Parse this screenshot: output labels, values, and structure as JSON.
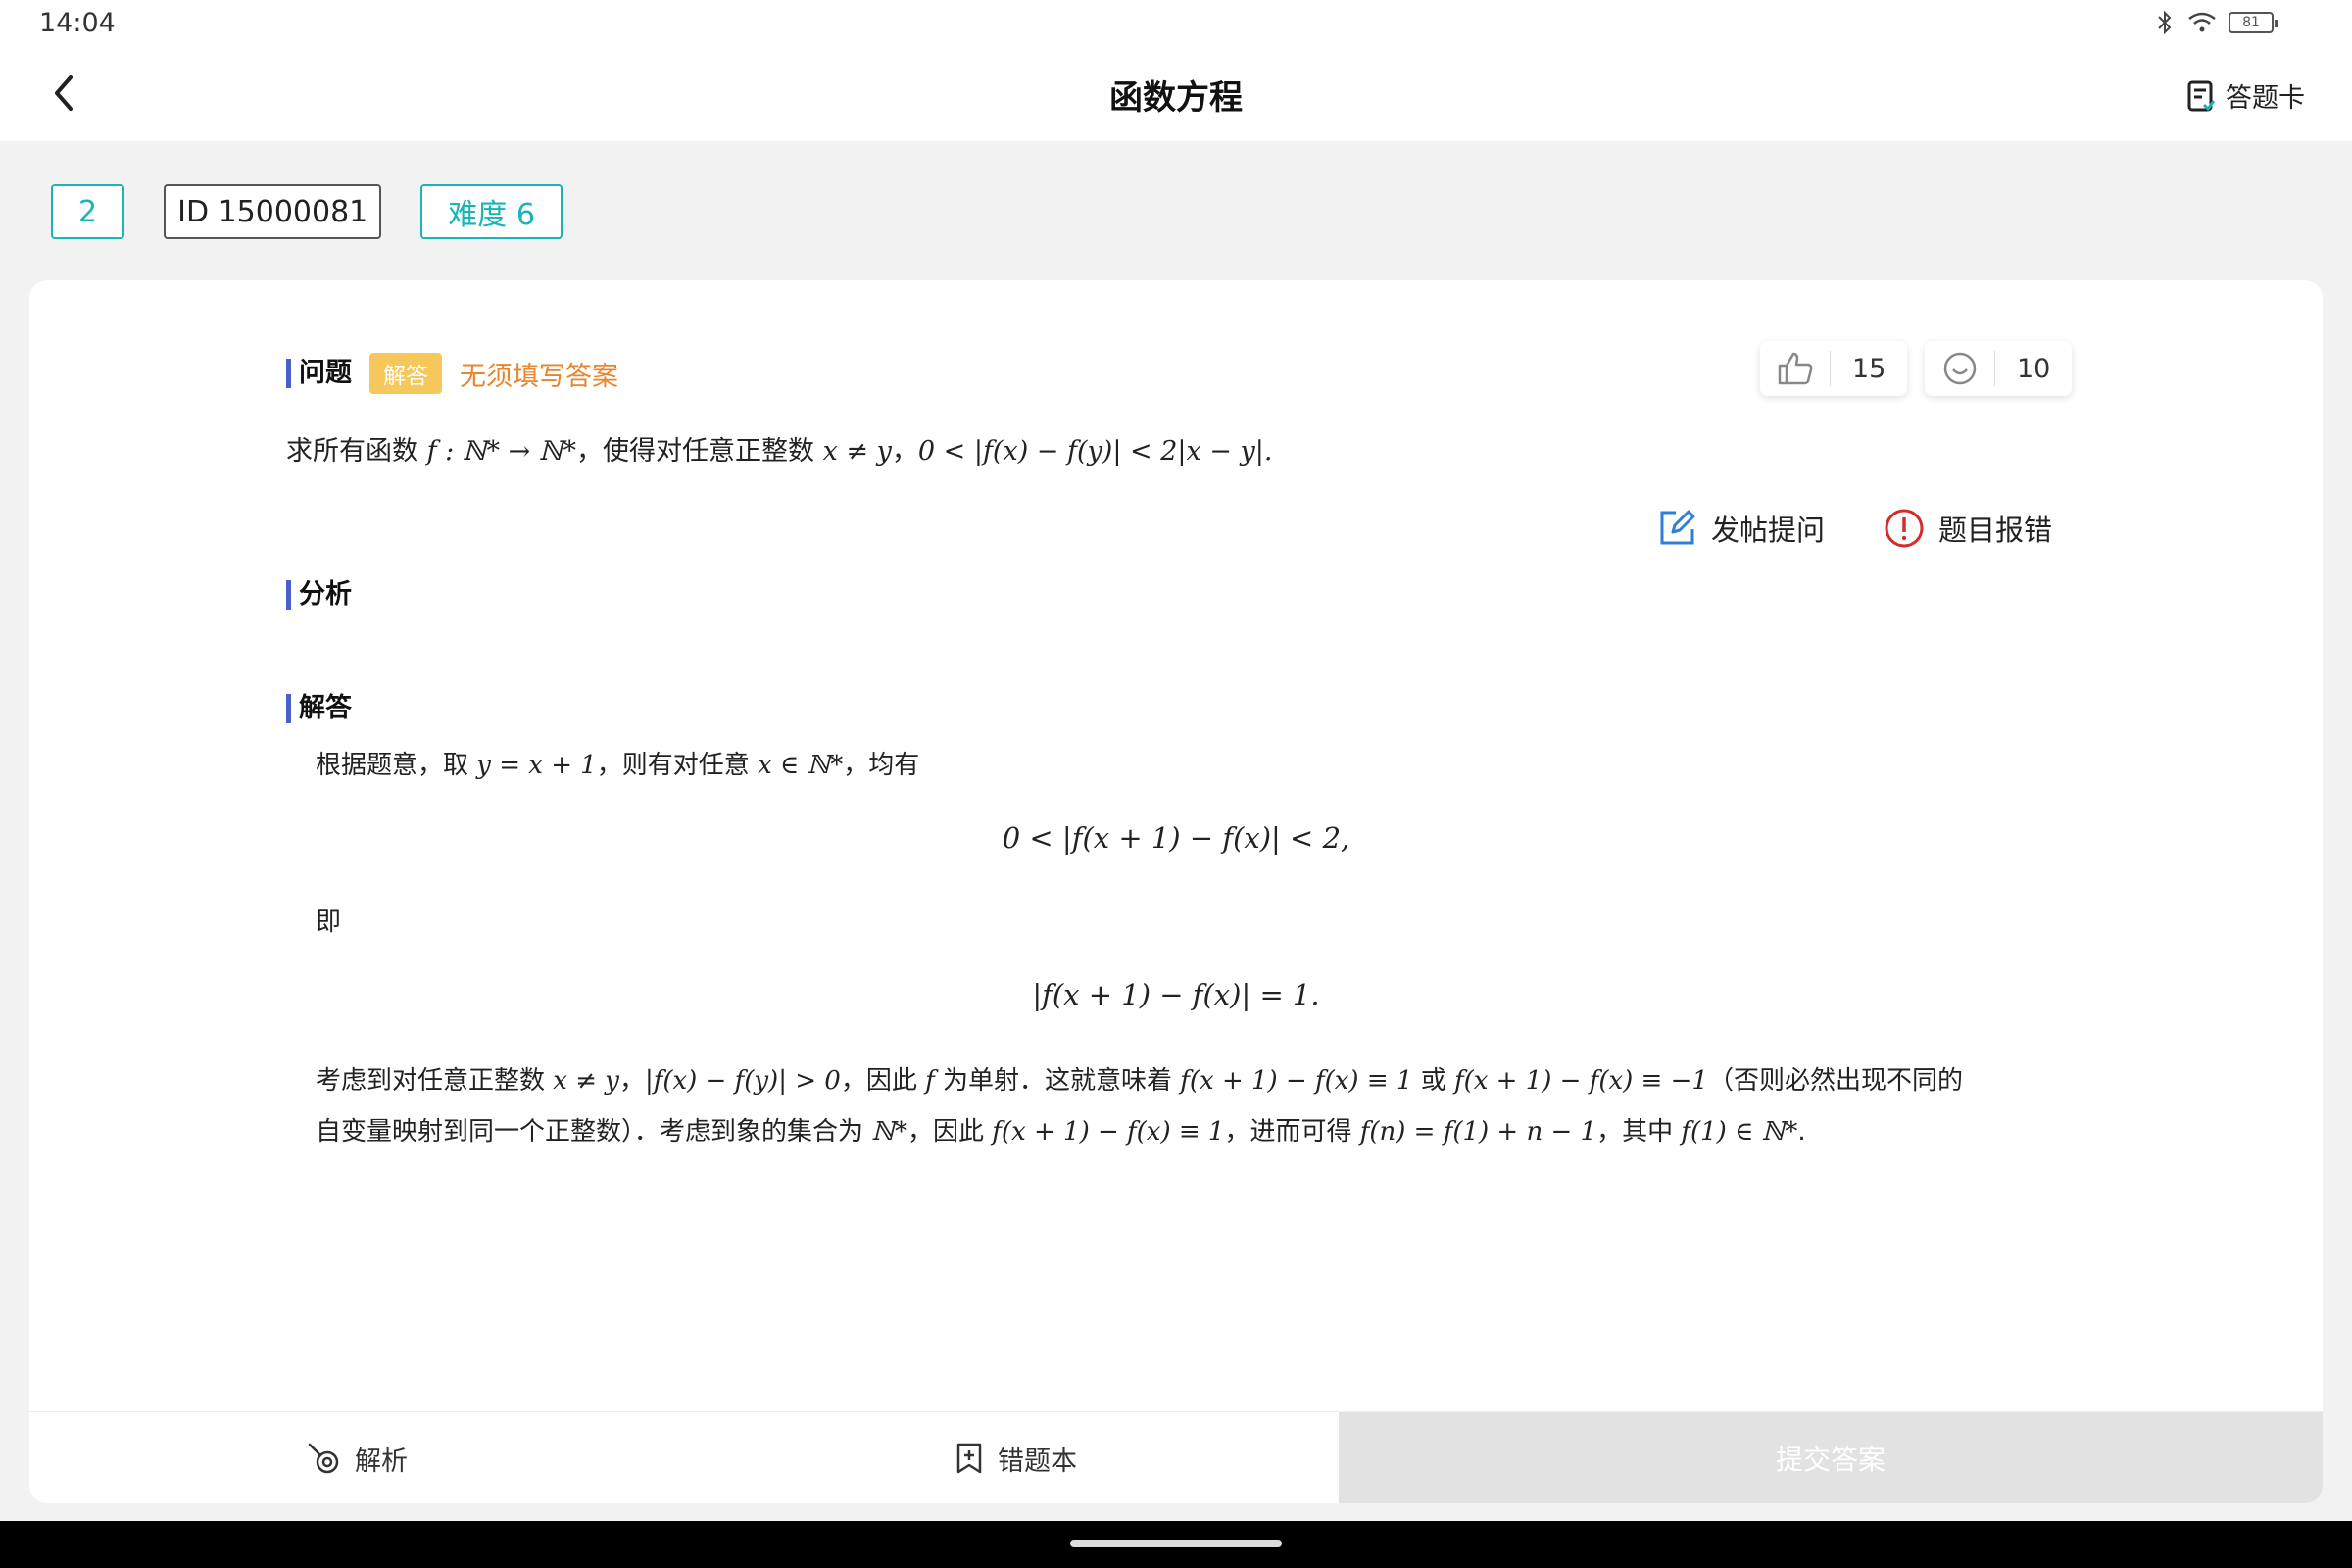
{
  "status": {
    "time": "14:04",
    "battery": "81"
  },
  "header": {
    "title": "函数方程",
    "answer_card": "答题卡"
  },
  "chips": {
    "index": "2",
    "id": "ID 15000081",
    "difficulty": "难度 6"
  },
  "question_section": {
    "title": "问题",
    "tag": "解答",
    "hint": "无须填写答案",
    "likes": "15",
    "other_count": "10",
    "text_prefix": "求所有函数 ",
    "text_math1": "f : ℕ* → ℕ*",
    "text_mid": "，使得对任意正整数 ",
    "text_math2": "x ≠ y",
    "text_sep": "，",
    "text_math3": "0 < |f(x) − f(y)| < 2|x − y|."
  },
  "actions": {
    "post": "发帖提问",
    "report": "题目报错"
  },
  "analysis": {
    "title": "分析"
  },
  "solution": {
    "title": "解答",
    "p1_a": "根据题意，取 ",
    "p1_m1": "y = x + 1",
    "p1_b": "，则有对任意 ",
    "p1_m2": "x ∈ ℕ*",
    "p1_c": "，均有",
    "eq1": "0 < |f(x + 1) − f(x)| < 2,",
    "p2": "即",
    "eq2": "|f(x + 1) − f(x)| = 1.",
    "p3_a": "考虑到对任意正整数 ",
    "p3_m1": "x ≠ y",
    "p3_b": "，",
    "p3_m2": "|f(x) − f(y)| > 0",
    "p3_c": "，因此 ",
    "p3_m3": "f",
    "p3_d": " 为单射．这就意味着 ",
    "p3_m4": "f(x + 1) − f(x) ≡ 1",
    "p3_e": " 或 ",
    "p3_m5": "f(x + 1) − f(x) ≡ −1",
    "p3_f": "（否则必然出现不同的",
    "p4_a": "自变量映射到同一个正整数）．考虑到象的集合为 ",
    "p4_m1": "ℕ*",
    "p4_b": "，因此 ",
    "p4_m2": "f(x + 1) − f(x) ≡ 1",
    "p4_c": "，进而可得 ",
    "p4_m3": "f(n) = f(1) + n − 1",
    "p4_d": "，其中 ",
    "p4_m4": "f(1) ∈ ℕ*",
    "p4_e": "."
  },
  "bottom": {
    "analysis": "解析",
    "wrongbook": "错题本",
    "submit": "提交答案"
  }
}
